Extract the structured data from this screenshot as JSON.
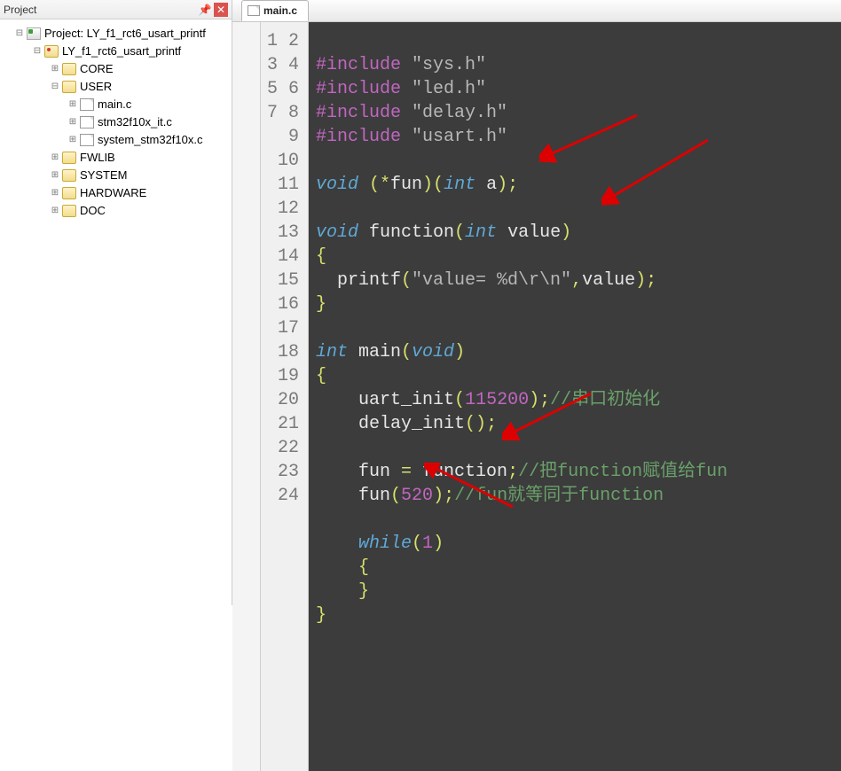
{
  "panel": {
    "title": "Project"
  },
  "tree": {
    "root": "Project: LY_f1_rct6_usart_printf",
    "target": "LY_f1_rct6_usart_printf",
    "core": "CORE",
    "user": "USER",
    "user_files": [
      "main.c",
      "stm32f10x_it.c",
      "system_stm32f10x.c"
    ],
    "fwlib": "FWLIB",
    "system": "SYSTEM",
    "hardware": "HARDWARE",
    "doc": "DOC"
  },
  "tab": {
    "filename": "main.c"
  },
  "code": {
    "lines_count": 24,
    "l1": {
      "pre": "#include ",
      "str": "\"sys.h\""
    },
    "l2": {
      "pre": "#include ",
      "str": "\"led.h\""
    },
    "l3": {
      "pre": "#include ",
      "str": "\"delay.h\""
    },
    "l4": {
      "pre": "#include ",
      "str": "\"usart.h\""
    },
    "l6": {
      "kw": "void ",
      "op1": "(*",
      "id": "fun",
      "op2": ")(",
      "typ": "int ",
      "arg": "a",
      "op3": ");"
    },
    "l8": {
      "kw": "void ",
      "fn": "function",
      "op1": "(",
      "typ": "int ",
      "arg": "value",
      "op2": ")"
    },
    "l9": "{",
    "l10": {
      "fn": "  printf",
      "op1": "(",
      "str": "\"value= %d\\r\\n\"",
      "comma": ",",
      "arg": "value",
      "op2": ");"
    },
    "l11": "}",
    "l13": {
      "typ": "int ",
      "fn": "main",
      "op1": "(",
      "kw": "void",
      "op2": ")"
    },
    "l14": "{",
    "l15": {
      "indent": "    ",
      "fn": "uart_init",
      "op1": "(",
      "num": "115200",
      "op2": ");",
      "cmt": "//串口初始化"
    },
    "l16": {
      "indent": "    ",
      "fn": "delay_init",
      "op1": "()",
      "op2": ";"
    },
    "l18": {
      "indent": "    ",
      "lhs": "fun ",
      "op1": "= ",
      "rhs": "function",
      "op2": ";",
      "cmt": "//把function赋值给fun"
    },
    "l19": {
      "indent": "    ",
      "fn": "fun",
      "op1": "(",
      "num": "520",
      "op2": ");",
      "cmt": "//fun就等同于function"
    },
    "l21": {
      "indent": "    ",
      "kw": "while",
      "op1": "(",
      "num": "1",
      "op2": ")"
    },
    "l22": {
      "indent": "    ",
      "brace": "{"
    },
    "l23": {
      "indent": "    ",
      "brace": "}"
    },
    "l24": "}"
  }
}
